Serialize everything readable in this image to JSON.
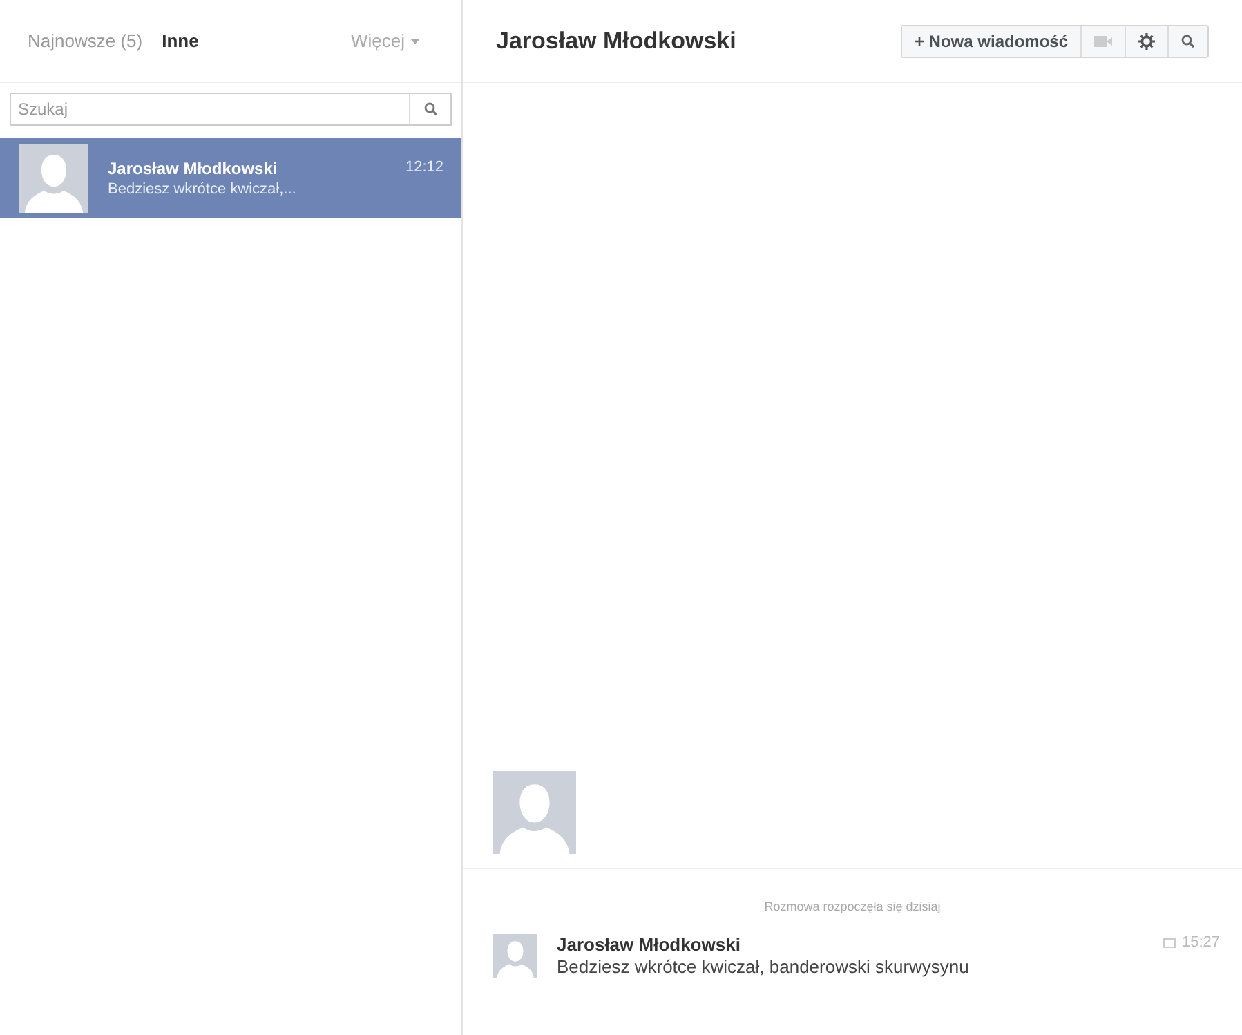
{
  "sidebar": {
    "tabs": [
      {
        "label": "Najnowsze (5)",
        "selected": false
      },
      {
        "label": "Inne",
        "selected": true
      }
    ],
    "more": {
      "label": "Więcej"
    },
    "search": {
      "placeholder": "Szukaj"
    },
    "conversations": [
      {
        "name": "Jarosław Młodkowski",
        "time": "12:12",
        "snippet": "Bedziesz wkrótce kwiczał,...",
        "selected": true
      }
    ]
  },
  "conversation": {
    "title": "Jarosław Młodkowski",
    "new_message": "+ Nowa wiadomość",
    "started": "Rozmowa rozpoczęła się dzisiaj",
    "messages": [
      {
        "sender": "Jarosław Młodkowski",
        "text": "Bedziesz wkrótce kwiczał, banderowski skurwysynu",
        "time": "15:27"
      }
    ]
  }
}
